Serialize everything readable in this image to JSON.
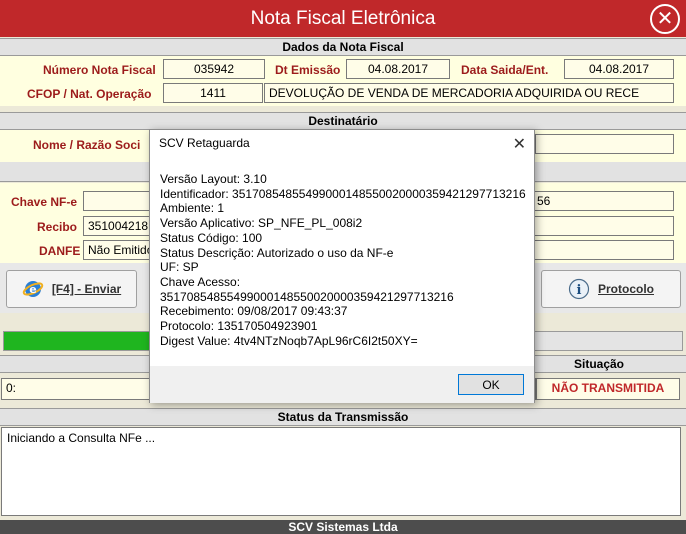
{
  "window": {
    "title": "Nota Fiscal Eletrônica",
    "close_glyph": "✕"
  },
  "dados": {
    "header": "Dados da Nota Fiscal",
    "numero_label": "Número Nota Fiscal",
    "numero_value": "035942",
    "emissao_label": "Dt Emissão",
    "emissao_value": "04.08.2017",
    "saida_label": "Data Saida/Ent.",
    "saida_value": "04.08.2017",
    "cfop_label": "CFOP / Nat. Operação",
    "cfop_value": "1411",
    "natureza_value": "DEVOLUÇÃO DE VENDA DE MERCADORIA ADQUIRIDA OU RECE"
  },
  "destinatario": {
    "header": "Destinatário",
    "nome_label": "Nome / Razão Soci"
  },
  "nfe": {
    "chave_label": "Chave NF-e",
    "chave_suffix": "56",
    "recibo_label": "Recibo",
    "recibo_value": "3510042181",
    "danfe_label": "DANFE",
    "danfe_value": "Não Emitido"
  },
  "buttons": {
    "enviar_label": "[F4] - Enviar",
    "protocolo_label": "Protocolo"
  },
  "progress": {
    "percent": 36
  },
  "situacao": {
    "header": "Situação",
    "left_value": "0:",
    "value": "NÃO TRANSMITIDA"
  },
  "status": {
    "header": "Status da Transmissão",
    "text": "Iniciando a Consulta NFe ..."
  },
  "footer": {
    "text": "SCV Sistemas Ltda"
  },
  "dialog": {
    "title": "SCV Retaguarda",
    "close_glyph": "✕",
    "lines": [
      "Versão Layout: 3.10",
      "Identificador: 35170854855499000148550020000359421297713216",
      "Ambiente: 1",
      "Versão Aplicativo: SP_NFE_PL_008i2",
      "Status Código: 100",
      "Status Descrição: Autorizado o uso da NF-e",
      "UF: SP",
      "Chave Acesso: 35170854855499000148550020000359421297713216",
      "Recebimento: 09/08/2017 09:43:37",
      "Protocolo: 135170504923901",
      "Digest Value: 4tv4NTzNoqb7ApL96rC6I2t50XY="
    ],
    "ok_label": "OK"
  },
  "colors": {
    "titlebar": "#c0282a",
    "label_red": "#9c1b1b",
    "progress_fill": "#1fb51f",
    "status_red": "#c0282a"
  }
}
